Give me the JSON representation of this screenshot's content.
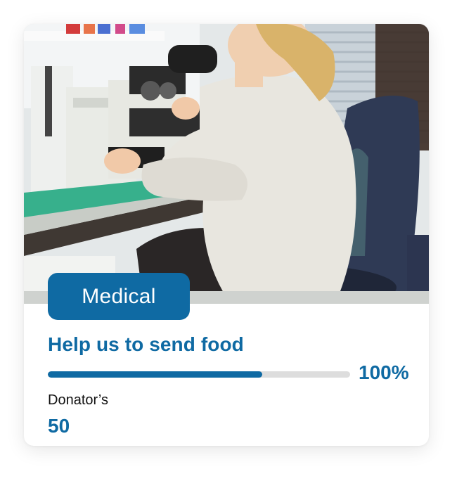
{
  "card": {
    "image": {
      "description_icon": "lab-photo",
      "accent_colors": {
        "lab_coat": "#e8e6df",
        "chair": "#2f3a55",
        "bench": "#3f3833",
        "mat": "#37b08c"
      }
    },
    "category": "Medical",
    "title": "Help us to send food",
    "progress": {
      "fraction": 0.71,
      "percent_label": "100%"
    },
    "donators": {
      "label": "Donator’s",
      "value": "50"
    }
  },
  "colors": {
    "primary": "#0f6aa3",
    "track": "#dddddd",
    "text": "#111111"
  }
}
